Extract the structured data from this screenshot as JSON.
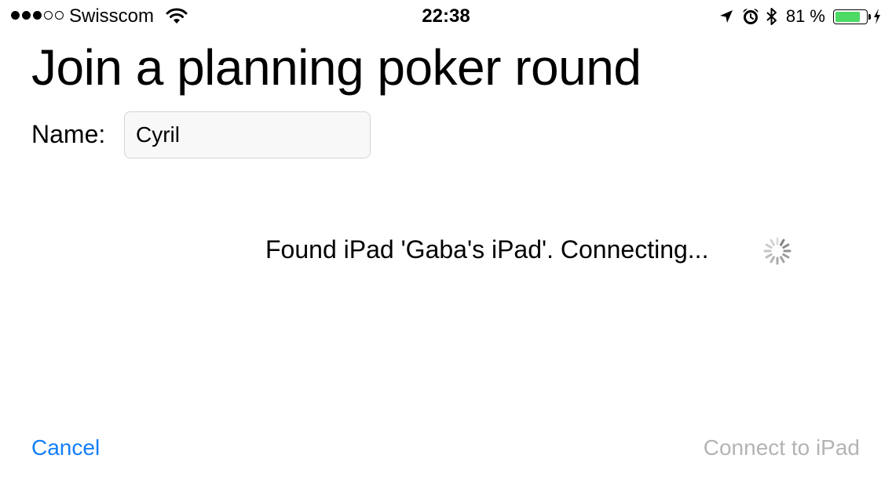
{
  "status_bar": {
    "signal_strength": {
      "filled": 3,
      "total": 5
    },
    "carrier": "Swisscom",
    "wifi_icon": "wifi-icon",
    "time": "22:38",
    "icons": [
      "location-arrow-icon",
      "alarm-clock-icon",
      "bluetooth-icon"
    ],
    "battery_percent_label": "81 %",
    "battery_level": 0.81,
    "battery_color": "#4cd964",
    "charging_icon": "lightning-bolt-icon"
  },
  "main": {
    "title": "Join a planning poker round",
    "name_label": "Name:",
    "name_value": "Cyril",
    "status_message": "Found iPad 'Gaba's iPad'. Connecting...",
    "spinner_icon": "activity-spinner-icon"
  },
  "actions": {
    "cancel_label": "Cancel",
    "connect_label": "Connect to iPad",
    "accent_color": "#147efb",
    "disabled_color": "#b4b4b4"
  }
}
